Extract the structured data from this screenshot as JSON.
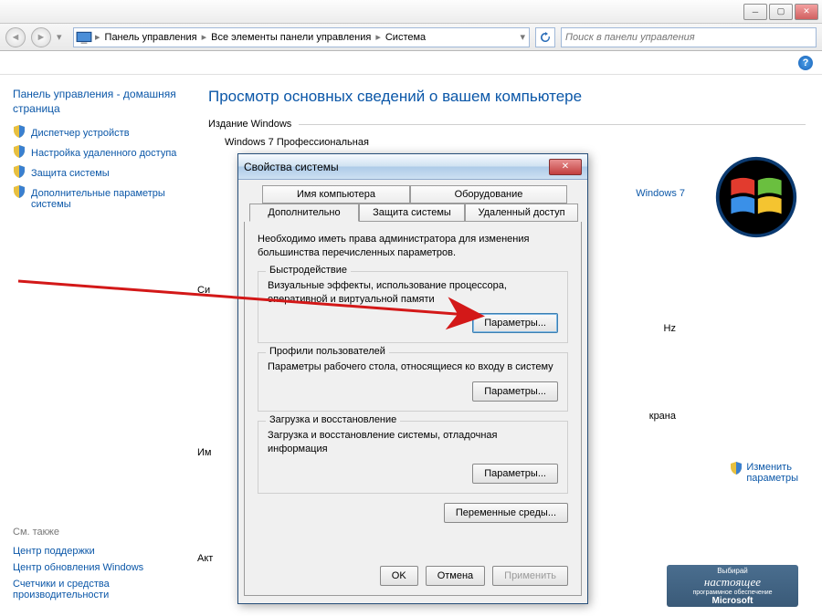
{
  "breadcrumb": {
    "items": [
      "Панель управления",
      "Все элементы панели управления",
      "Система"
    ]
  },
  "search": {
    "placeholder": "Поиск в панели управления"
  },
  "sidebar": {
    "home": "Панель управления - домашняя страница",
    "links": [
      "Диспетчер устройств",
      "Настройка удаленного доступа",
      "Защита системы",
      "Дополнительные параметры системы"
    ],
    "see_also_label": "См. также",
    "see_also": [
      "Центр поддержки",
      "Центр обновления Windows",
      "Счетчики и средства производительности"
    ]
  },
  "content": {
    "heading": "Просмотр основных сведений о вашем компьютере",
    "edition_label": "Издание Windows",
    "edition_name": "Windows 7 Профессиональная",
    "brand_link": "Windows 7",
    "sys_label_short": "Си",
    "name_label_short": "Им",
    "act_label_short": "Акт",
    "hz_suffix": "Hz",
    "screen_suffix": "крана",
    "change_link_l1": "Изменить",
    "change_link_l2": "параметры",
    "genuine": {
      "l1": "Выбирай",
      "l2": "настоящее",
      "l3": "программное обеспечение",
      "l4": "Microsoft"
    }
  },
  "dialog": {
    "title": "Свойства системы",
    "tabs": {
      "computer_name": "Имя компьютера",
      "hardware": "Оборудование",
      "advanced": "Дополнительно",
      "system_protection": "Защита системы",
      "remote": "Удаленный доступ"
    },
    "note": "Необходимо иметь права администратора для изменения большинства перечисленных параметров.",
    "performance": {
      "legend": "Быстродействие",
      "text": "Визуальные эффекты, использование процессора, оперативной и виртуальной памяти",
      "button": "Параметры..."
    },
    "profiles": {
      "legend": "Профили пользователей",
      "text": "Параметры рабочего стола, относящиеся ко входу в систему",
      "button": "Параметры..."
    },
    "startup": {
      "legend": "Загрузка и восстановление",
      "text": "Загрузка и восстановление системы, отладочная информация",
      "button": "Параметры..."
    },
    "env_vars_button": "Переменные среды...",
    "ok": "OK",
    "cancel": "Отмена",
    "apply": "Применить"
  }
}
